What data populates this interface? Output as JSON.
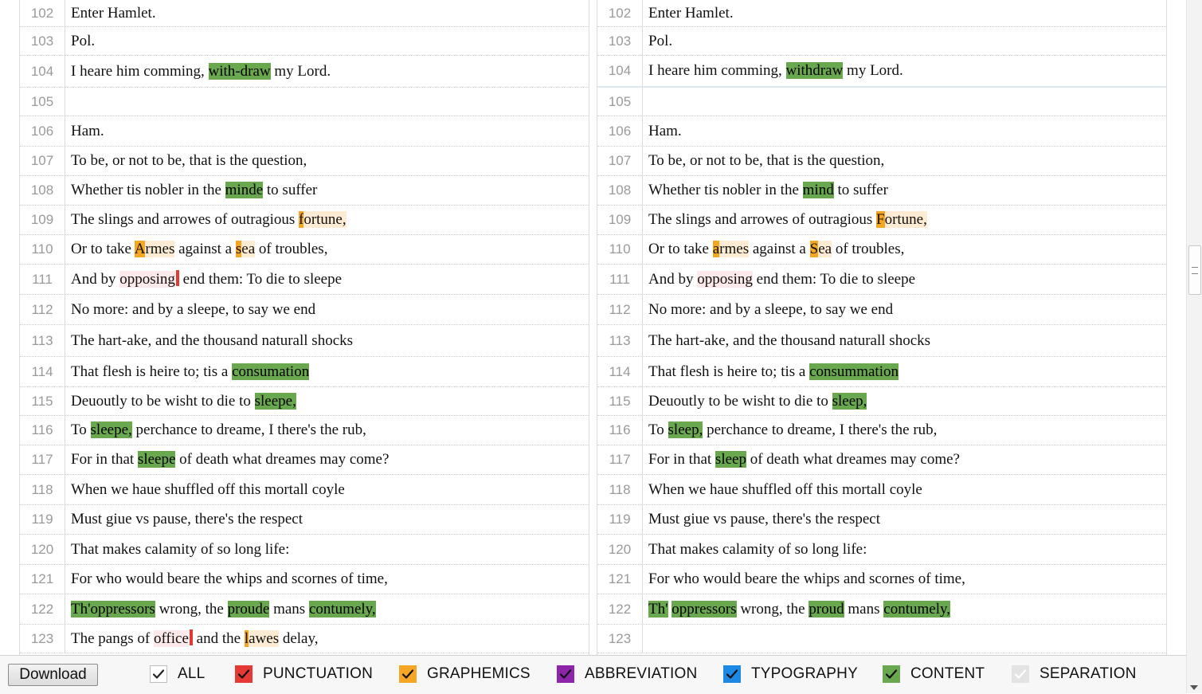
{
  "toolbar": {
    "download_label": "Download",
    "filters": [
      {
        "label": "ALL",
        "color": "#ffffff",
        "checked": true
      },
      {
        "label": "PUNCTUATION",
        "color": "#e53935",
        "checked": true
      },
      {
        "label": "GRAPHEMICS",
        "color": "#f5a623",
        "checked": true
      },
      {
        "label": "ABBREVIATION",
        "color": "#8e24aa",
        "checked": true
      },
      {
        "label": "TYPOGRAPHY",
        "color": "#1e88e5",
        "checked": true
      },
      {
        "label": "CONTENT",
        "color": "#6aa84f",
        "checked": true
      },
      {
        "label": "SEPARATION",
        "color": "#e3e3e3",
        "checked": true
      }
    ]
  },
  "colors": {
    "content": "#6aa84f",
    "graphemics": "#f5a623",
    "graphemics_light": "#fdebd3",
    "punctuation": "#e53935",
    "punctuation_light": "#fde8ea"
  },
  "left": {
    "lines": [
      {
        "n": "102",
        "segs": [
          {
            "t": "Enter Hamlet."
          }
        ]
      },
      {
        "n": "103",
        "segs": [
          {
            "t": "Pol."
          }
        ]
      },
      {
        "n": "104",
        "segs": [
          {
            "t": "I heare him comming, "
          },
          {
            "t": "with-draw",
            "c": "content"
          },
          {
            "t": " my Lord."
          }
        ]
      },
      {
        "n": "105",
        "segs": []
      },
      {
        "n": "106",
        "segs": [
          {
            "t": "Ham."
          }
        ]
      },
      {
        "n": "107",
        "segs": [
          {
            "t": "To be, or not to be, that is the question,"
          }
        ]
      },
      {
        "n": "108",
        "segs": [
          {
            "t": "Whether tis nobler in the "
          },
          {
            "t": "minde",
            "c": "content"
          },
          {
            "t": " to suffer"
          }
        ]
      },
      {
        "n": "109",
        "segs": [
          {
            "t": "The slings and arrowes of outragious "
          },
          {
            "t": "f",
            "c": "graph-strong"
          },
          {
            "t": "ortune,",
            "c": "graph"
          }
        ]
      },
      {
        "n": "110",
        "segs": [
          {
            "t": "Or to take "
          },
          {
            "t": "A",
            "c": "graph-strong"
          },
          {
            "t": "rmes",
            "c": "graph"
          },
          {
            "t": " against a "
          },
          {
            "t": "s",
            "c": "graph-strong"
          },
          {
            "t": "ea",
            "c": "graph"
          },
          {
            "t": " of troubles,"
          }
        ]
      },
      {
        "n": "111",
        "segs": [
          {
            "t": "And by "
          },
          {
            "t": "opposing",
            "c": "punct"
          },
          {
            "t": "",
            "c": "punct-mark"
          },
          {
            "t": " end them: To die to sleepe"
          }
        ]
      },
      {
        "n": "112",
        "segs": [
          {
            "t": "No more: and by a sleepe, to say we end"
          }
        ]
      },
      {
        "n": "113",
        "segs": [
          {
            "t": "The hart-ake, and the thousand naturall shocks"
          }
        ]
      },
      {
        "n": "114",
        "segs": [
          {
            "t": "That flesh is heire to; tis a "
          },
          {
            "t": "consumation",
            "c": "content"
          }
        ]
      },
      {
        "n": "115",
        "segs": [
          {
            "t": "Deuoutly to be wisht to die to "
          },
          {
            "t": "sleepe,",
            "c": "content"
          }
        ]
      },
      {
        "n": "116",
        "segs": [
          {
            "t": "To "
          },
          {
            "t": "sleepe,",
            "c": "content"
          },
          {
            "t": " perchance to dreame, I there's the rub,"
          }
        ]
      },
      {
        "n": "117",
        "segs": [
          {
            "t": "For in that "
          },
          {
            "t": "sleepe",
            "c": "content"
          },
          {
            "t": " of death what dreames may come?"
          }
        ]
      },
      {
        "n": "118",
        "segs": [
          {
            "t": "When we haue shuffled off this mortall coyle"
          }
        ]
      },
      {
        "n": "119",
        "segs": [
          {
            "t": "Must giue vs pause, there's the respect"
          }
        ]
      },
      {
        "n": "120",
        "segs": [
          {
            "t": "That makes calamity of so long life:"
          }
        ]
      },
      {
        "n": "121",
        "segs": [
          {
            "t": "For who would beare the whips and scornes of time,"
          }
        ]
      },
      {
        "n": "122",
        "segs": [
          {
            "t": "Th'oppressors",
            "c": "content"
          },
          {
            "t": " wrong, the "
          },
          {
            "t": "proude",
            "c": "content"
          },
          {
            "t": " mans "
          },
          {
            "t": "contumely,",
            "c": "content"
          }
        ]
      },
      {
        "n": "123",
        "segs": [
          {
            "t": "The pangs of "
          },
          {
            "t": "office",
            "c": "punct"
          },
          {
            "t": "",
            "c": "punct-mark"
          },
          {
            "t": " and the "
          },
          {
            "t": "l",
            "c": "graph-strong"
          },
          {
            "t": "awes",
            "c": "graph"
          },
          {
            "t": " delay,"
          }
        ]
      }
    ]
  },
  "right": {
    "lines": [
      {
        "n": "102",
        "segs": [
          {
            "t": "Enter Hamlet."
          }
        ]
      },
      {
        "n": "103",
        "segs": [
          {
            "t": "Pol."
          }
        ]
      },
      {
        "n": "104",
        "segs": [
          {
            "t": "I heare him comming, "
          },
          {
            "t": "withdraw",
            "c": "content"
          },
          {
            "t": " my Lord."
          }
        ]
      },
      {
        "n": "105",
        "segs": []
      },
      {
        "n": "106",
        "segs": [
          {
            "t": "Ham."
          }
        ]
      },
      {
        "n": "107",
        "segs": [
          {
            "t": "To be, or not to be, that is the question,"
          }
        ]
      },
      {
        "n": "108",
        "segs": [
          {
            "t": "Whether tis nobler in the "
          },
          {
            "t": "mind",
            "c": "content"
          },
          {
            "t": " to suffer"
          }
        ]
      },
      {
        "n": "109",
        "segs": [
          {
            "t": "The slings and arrowes of outragious "
          },
          {
            "t": "F",
            "c": "graph-strong"
          },
          {
            "t": "ortune,",
            "c": "graph"
          }
        ]
      },
      {
        "n": "110",
        "segs": [
          {
            "t": "Or to take "
          },
          {
            "t": "a",
            "c": "graph-strong"
          },
          {
            "t": "rmes",
            "c": "graph"
          },
          {
            "t": " against a "
          },
          {
            "t": "S",
            "c": "graph-strong"
          },
          {
            "t": "ea",
            "c": "graph"
          },
          {
            "t": " of troubles,"
          }
        ]
      },
      {
        "n": "111",
        "segs": [
          {
            "t": "And by "
          },
          {
            "t": "opposing",
            "c": "punct"
          },
          {
            "t": " end them: To die to sleepe"
          }
        ]
      },
      {
        "n": "112",
        "segs": [
          {
            "t": "No more: and by a sleepe, to say we end"
          }
        ]
      },
      {
        "n": "113",
        "segs": [
          {
            "t": "The hart-ake, and the thousand naturall shocks"
          }
        ]
      },
      {
        "n": "114",
        "segs": [
          {
            "t": "That flesh is heire to; tis a "
          },
          {
            "t": "consummation",
            "c": "content"
          }
        ]
      },
      {
        "n": "115",
        "segs": [
          {
            "t": "Deuoutly to be wisht to die to "
          },
          {
            "t": "sleep,",
            "c": "content"
          }
        ]
      },
      {
        "n": "116",
        "segs": [
          {
            "t": "To "
          },
          {
            "t": "sleep,",
            "c": "content"
          },
          {
            "t": " perchance to dreame, I there's the rub,"
          }
        ]
      },
      {
        "n": "117",
        "segs": [
          {
            "t": "For in that "
          },
          {
            "t": "sleep",
            "c": "content"
          },
          {
            "t": " of death what dreames may come?"
          }
        ]
      },
      {
        "n": "118",
        "segs": [
          {
            "t": "When we haue shuffled off this mortall coyle"
          }
        ]
      },
      {
        "n": "119",
        "segs": [
          {
            "t": "Must giue vs pause, there's the respect"
          }
        ]
      },
      {
        "n": "120",
        "segs": [
          {
            "t": "That makes calamity of so long life:"
          }
        ]
      },
      {
        "n": "121",
        "segs": [
          {
            "t": "For who would beare the whips and scornes of time,"
          }
        ]
      },
      {
        "n": "122",
        "segs": [
          {
            "t": "Th'",
            "c": "content"
          },
          {
            "t": " "
          },
          {
            "t": "oppressors",
            "c": "content"
          },
          {
            "t": " wrong, the "
          },
          {
            "t": "proud",
            "c": "content"
          },
          {
            "t": " mans "
          },
          {
            "t": "contumely,",
            "c": "content"
          }
        ]
      },
      {
        "n": "123",
        "segs": []
      }
    ]
  }
}
